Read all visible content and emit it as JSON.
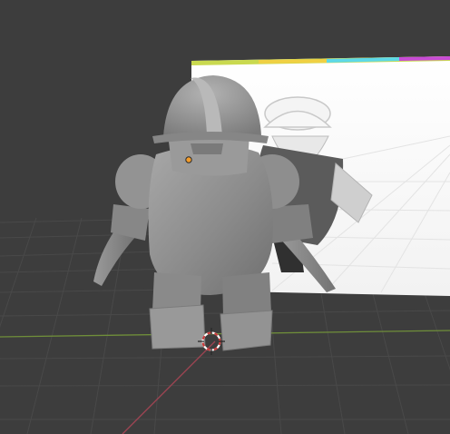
{
  "viewport": {
    "kind": "3D viewport",
    "background": "#3d3d3d",
    "grid_color": "#4a4a4a",
    "x_axis_color": "#7ea23f",
    "y_axis_color": "#b24a5a",
    "grid_visible": true
  },
  "scene": {
    "main_model": {
      "name": "",
      "material": "gray clay",
      "color": "#8e8e8e",
      "helmet": true,
      "selected_origin_color": "#f39c2a"
    },
    "reference_image": {
      "visible": true,
      "description_visible_text": ""
    },
    "cursor_3d": {
      "visible": true,
      "colors": [
        "#c73b3b",
        "#ffffff"
      ]
    }
  },
  "icons": {
    "origin": "origin-dot-icon",
    "cursor": "3d-cursor-icon"
  }
}
